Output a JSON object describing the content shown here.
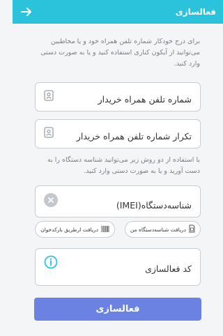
{
  "header": {
    "title": "فعالسازی",
    "back_icon": "arrow-right-icon",
    "color": "#2bc3dc"
  },
  "intro_text": "برای درج خودکار شماره تلفن همراه خود و یا مخاطبین می‌توانید از آیکون کناری استفاده کنید و یا به صورت دستی وارد کنید.",
  "phone_field": {
    "label": "شماره تلفن همراه خریدار",
    "icon": "contact-card-icon"
  },
  "phone_repeat_field": {
    "label": "تکرار شماره تلفن همراه خریدار",
    "icon": "contact-card-icon"
  },
  "imei_text": "با استفاده از دو روش زیر می‌توانید شناسه دستگاه را به دست آورید و یا به صورت دستی وارد کنید.",
  "imei_field": {
    "label": "شناسه‌دستگاه(IMEI)",
    "icon": "clear-icon"
  },
  "actions": {
    "get_my_device": "دریافت شناسه‌دستگاه من",
    "get_by_barcode": "دریافت ازطریق بارکدخوان"
  },
  "activation_field": {
    "label": "کد فعالسازی",
    "icon": "info-icon"
  },
  "submit": {
    "label": "فعالسازی",
    "color": "#6c82e3"
  }
}
